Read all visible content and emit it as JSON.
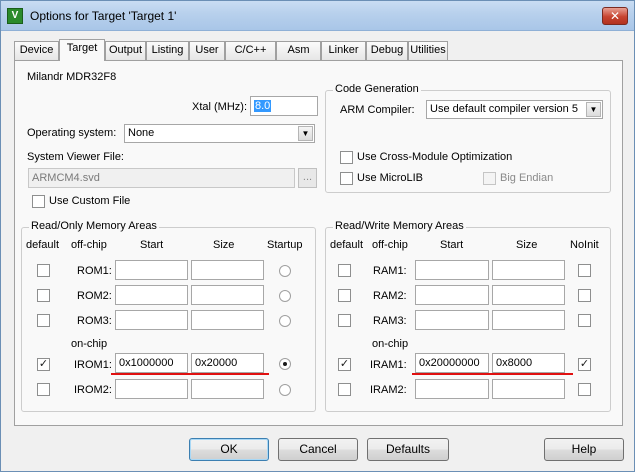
{
  "window": {
    "title": "Options for Target 'Target 1'",
    "icon": "uvision-icon",
    "close_glyph": "✕"
  },
  "tabs": [
    "Device",
    "Target",
    "Output",
    "Listing",
    "User",
    "C/C++",
    "Asm",
    "Linker",
    "Debug",
    "Utilities"
  ],
  "active_tab": "Target",
  "device_name": "Milandr MDR32F8",
  "xtal": {
    "label": "Xtal (MHz):",
    "value": "8.0"
  },
  "os": {
    "label": "Operating system:",
    "value": "None"
  },
  "svd": {
    "label": "System Viewer File:",
    "value": "ARMCM4.svd",
    "browse": "..."
  },
  "use_custom_file": {
    "label": "Use Custom File",
    "checked": false
  },
  "code_gen": {
    "title": "Code Generation",
    "compiler_label": "ARM Compiler:",
    "compiler_value": "Use default compiler version 5",
    "cross_module": {
      "label": "Use Cross-Module Optimization",
      "checked": false
    },
    "microlib": {
      "label": "Use MicroLIB",
      "checked": false
    },
    "big_endian": {
      "label": "Big Endian",
      "checked": false
    }
  },
  "ro": {
    "title": "Read/Only Memory Areas",
    "headers": {
      "default": "default",
      "offchip": "off-chip",
      "start": "Start",
      "size": "Size",
      "startup": "Startup"
    },
    "onchip_label": "on-chip",
    "rows": [
      {
        "name": "ROM1:",
        "default": false,
        "start": "",
        "size": "",
        "startup": false
      },
      {
        "name": "ROM2:",
        "default": false,
        "start": "",
        "size": "",
        "startup": false
      },
      {
        "name": "ROM3:",
        "default": false,
        "start": "",
        "size": "",
        "startup": false
      },
      {
        "name": "IROM1:",
        "default": true,
        "start": "0x1000000",
        "size": "0x20000",
        "startup": true
      },
      {
        "name": "IROM2:",
        "default": false,
        "start": "",
        "size": "",
        "startup": false
      }
    ]
  },
  "rw": {
    "title": "Read/Write Memory Areas",
    "headers": {
      "default": "default",
      "offchip": "off-chip",
      "start": "Start",
      "size": "Size",
      "noinit": "NoInit"
    },
    "onchip_label": "on-chip",
    "rows": [
      {
        "name": "RAM1:",
        "default": false,
        "start": "",
        "size": "",
        "noinit": false
      },
      {
        "name": "RAM2:",
        "default": false,
        "start": "",
        "size": "",
        "noinit": false
      },
      {
        "name": "RAM3:",
        "default": false,
        "start": "",
        "size": "",
        "noinit": false
      },
      {
        "name": "IRAM1:",
        "default": true,
        "start": "0x20000000",
        "size": "0x8000",
        "noinit": true
      },
      {
        "name": "IRAM2:",
        "default": false,
        "start": "",
        "size": "",
        "noinit": false
      }
    ]
  },
  "buttons": {
    "ok": "OK",
    "cancel": "Cancel",
    "defaults": "Defaults",
    "help": "Help"
  },
  "colors": {
    "highlight_line": "#e01010",
    "selection": "#3399ff"
  }
}
